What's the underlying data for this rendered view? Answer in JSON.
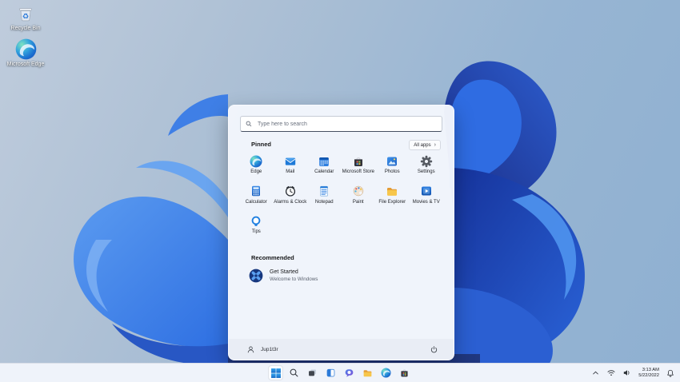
{
  "desktop": {
    "icons": [
      {
        "label": "Recycle Bin"
      },
      {
        "label": "Microsoft Edge"
      }
    ]
  },
  "start_menu": {
    "search_placeholder": "Type here to search",
    "pinned_title": "Pinned",
    "all_apps_label": "All apps",
    "apps": [
      {
        "label": "Edge"
      },
      {
        "label": "Mail"
      },
      {
        "label": "Calendar"
      },
      {
        "label": "Microsoft Store"
      },
      {
        "label": "Photos"
      },
      {
        "label": "Settings"
      },
      {
        "label": "Calculator"
      },
      {
        "label": "Alarms & Clock"
      },
      {
        "label": "Notepad"
      },
      {
        "label": "Paint"
      },
      {
        "label": "File Explorer"
      },
      {
        "label": "Movies & TV"
      },
      {
        "label": "Tips"
      }
    ],
    "recommended_title": "Recommended",
    "recommended_items": [
      {
        "title": "Get Started",
        "subtitle": "Welcome to Windows"
      }
    ],
    "user_name": "Jup1t3r"
  },
  "taskbar": {
    "icons": [
      "start",
      "search",
      "task-view",
      "widgets",
      "chat",
      "file-explorer",
      "edge",
      "microsoft-store"
    ],
    "tray": {
      "icons": [
        "chevron-up",
        "wifi",
        "volume",
        "clock",
        "notification-bell"
      ],
      "time": "3:13 AM",
      "date": "5/22/2022"
    }
  },
  "colors": {
    "accent": "#0b66c2",
    "bloom_dark": "#16339b",
    "bloom_bright": "#2e6fe2",
    "menu_bg": "#f2f5fb",
    "taskbar_bg": "#eff3fa"
  }
}
